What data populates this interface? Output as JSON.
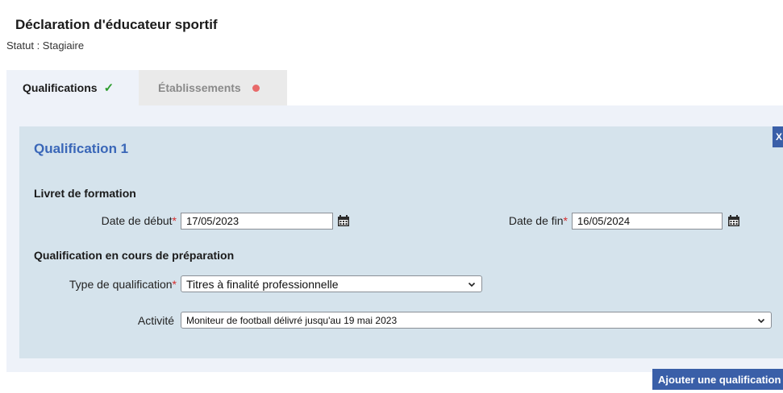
{
  "header": {
    "title": "Déclaration d'éducateur sportif",
    "status": "Statut : Stagiaire"
  },
  "tabs": [
    {
      "label": "Qualifications",
      "state": "complete",
      "indicator": "✓"
    },
    {
      "label": "Établissements",
      "state": "incomplete",
      "indicator": "red-dot"
    }
  ],
  "qualification": {
    "close_label": "X",
    "title": "Qualification 1",
    "livret": {
      "title": "Livret de formation",
      "start_label": "Date de début",
      "start_value": "17/05/2023",
      "end_label": "Date de fin",
      "end_value": "16/05/2024",
      "required_mark": "*"
    },
    "preparation": {
      "title": "Qualification en cours de préparation",
      "type_label": "Type de qualification",
      "type_value": "Titres à finalité professionnelle",
      "activity_label": "Activité",
      "activity_value": "Moniteur de football délivré jusqu'au 19 mai 2023"
    }
  },
  "actions": {
    "add_label": "Ajouter une qualification"
  },
  "colors": {
    "accent": "#3a5fa8",
    "title_blue": "#3a67b8",
    "panel_bg": "#d5e3ec",
    "required": "#d52b2b",
    "success": "#2e9d2e",
    "warning_dot": "#e86a6a"
  },
  "icons": {
    "calendar": "calendar-icon",
    "chevron": "chevron-down-icon",
    "check": "check-icon",
    "dot": "status-dot-icon"
  }
}
